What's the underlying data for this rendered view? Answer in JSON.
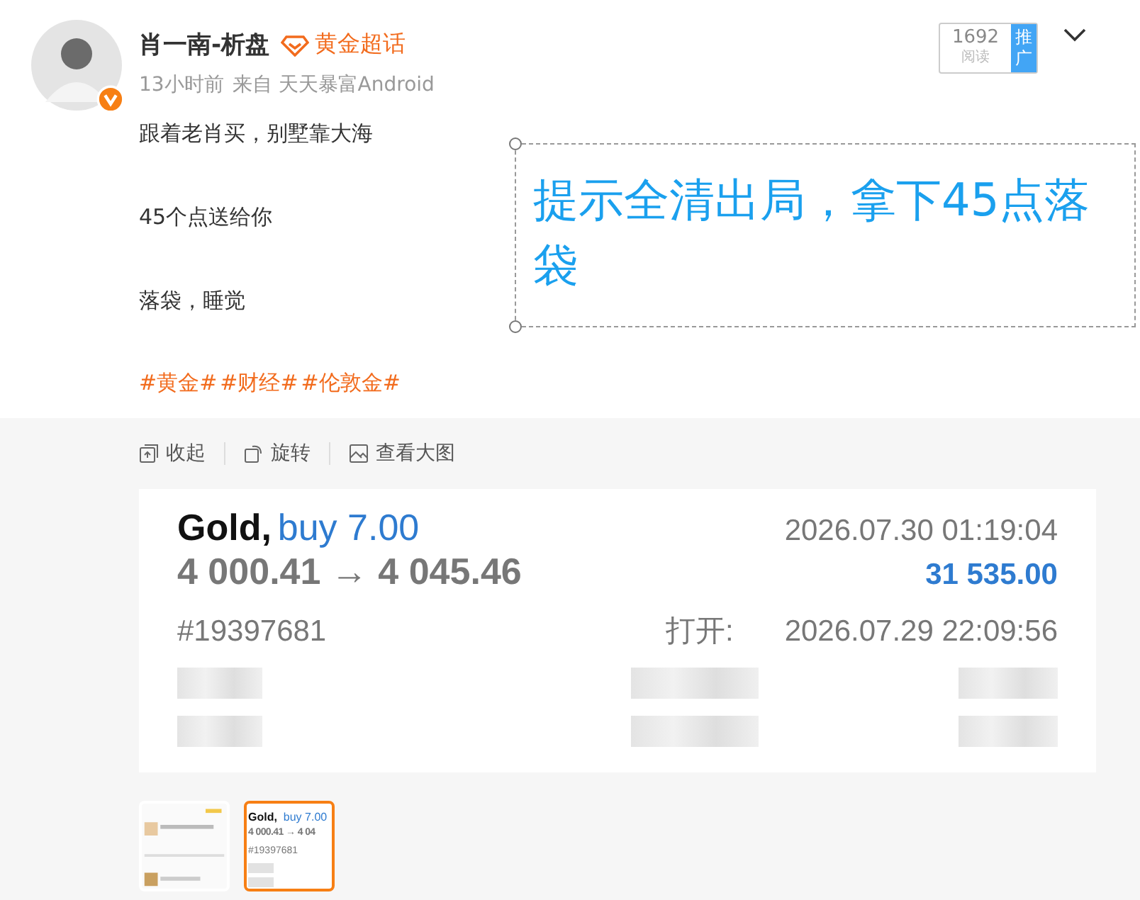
{
  "post": {
    "author": "肖一南-析盘",
    "verified": true,
    "badge": "黄金超话",
    "time": "13小时前",
    "source": "来自 天天暴富Android",
    "reads": "1692",
    "reads_label": "阅读",
    "promote": "推广",
    "paragraphs": [
      "跟着老肖买，别墅靠大海",
      "45个点送给你",
      "落袋，睡觉"
    ],
    "hashtags": [
      "#黄金#",
      "#财经#",
      "#伦敦金#"
    ]
  },
  "annotation": {
    "text": "提示全清出局，拿下45点落袋"
  },
  "image_toolbar": [
    {
      "kind": "collapse",
      "label": "收起"
    },
    {
      "kind": "rotate",
      "label": "旋转"
    },
    {
      "kind": "enlarge",
      "label": "查看大图"
    }
  ],
  "trade": {
    "symbol": "Gold,",
    "side": "buy 7.00",
    "prices": "4 000.41 → 4 045.46",
    "close_time": "2026.07.30 01:19:04",
    "profit": "31 535.00",
    "ticket": "#19397681",
    "open_label": "打开:",
    "open_time": "2026.07.29 22:09:56"
  },
  "thumbnails": [
    {
      "kind": "picture",
      "selected": false
    },
    {
      "kind": "trade",
      "selected": true,
      "lines": [
        "Gold,",
        "buy 7.00",
        "4 000.41 → 4 04",
        "#19397681"
      ]
    }
  ]
}
